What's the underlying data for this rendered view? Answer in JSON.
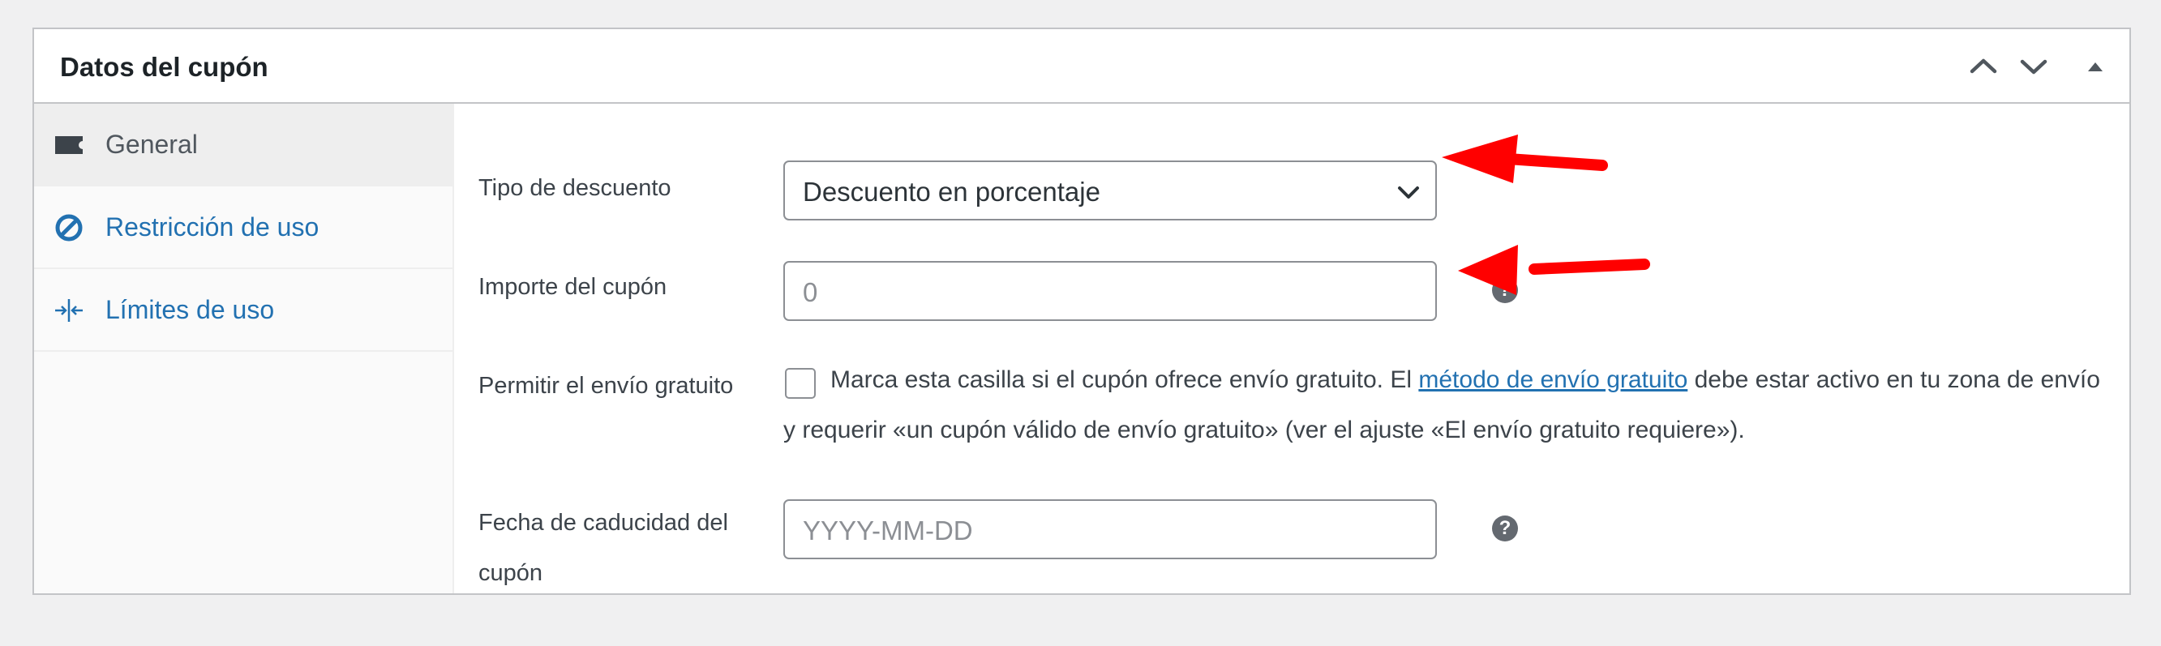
{
  "panel": {
    "title": "Datos del cupón",
    "controls": [
      "chevron-up-icon",
      "chevron-down-icon",
      "triangle-up-icon"
    ]
  },
  "tabs": [
    {
      "label": "General",
      "icon": "ticket-icon",
      "active": true
    },
    {
      "label": "Restricción de uso",
      "icon": "no-entry-icon",
      "active": false
    },
    {
      "label": "Límites de uso",
      "icon": "arrows-in-icon",
      "active": false
    }
  ],
  "form": {
    "discount_type": {
      "label": "Tipo de descuento",
      "value": "Descuento en porcentaje"
    },
    "coupon_amount": {
      "label": "Importe del cupón",
      "value": "0",
      "help": "?"
    },
    "free_shipping": {
      "label": "Permitir el envío gratuito",
      "checked": false,
      "text_before": "Marca esta casilla si el cupón ofrece envío gratuito. El ",
      "link": "método de envío gratuito",
      "text_after": " debe estar activo en tu zona de envío y requerir «un cupón válido de envío gratuito» (ver el ajuste «El envío gratuito requiere»)."
    },
    "expiry_date": {
      "label_line1": "Fecha de caducidad del",
      "label_line2": "cupón",
      "placeholder": "YYYY-MM-DD",
      "help": "?"
    }
  },
  "colors": {
    "link": "#2271b1",
    "annotation_arrow": "#ff0000",
    "border": "#c3c4c7"
  }
}
